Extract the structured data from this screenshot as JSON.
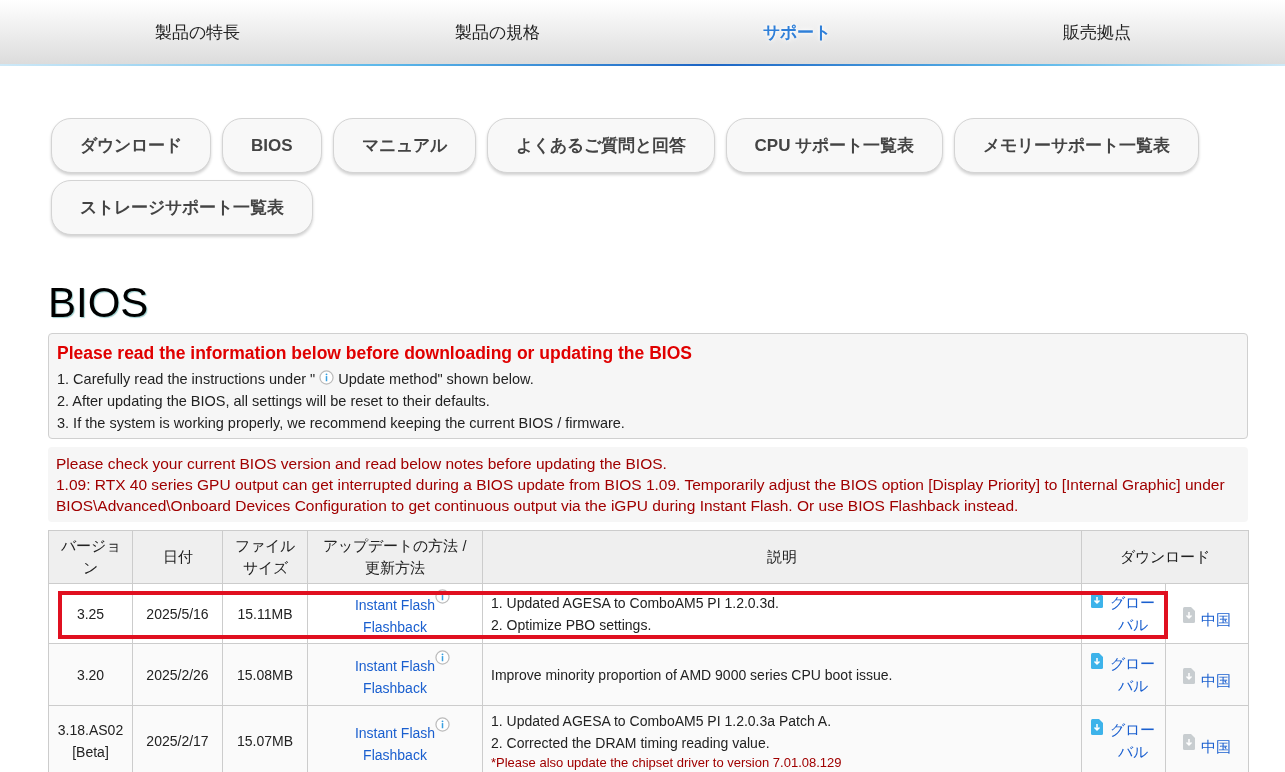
{
  "nav": {
    "items": [
      {
        "label": "製品の特長",
        "selected": false
      },
      {
        "label": "製品の規格",
        "selected": false
      },
      {
        "label": "サポート",
        "selected": true
      },
      {
        "label": "販売拠点",
        "selected": false
      }
    ]
  },
  "support_buttons": [
    "ダウンロード",
    "BIOS",
    "マニュアル",
    "よくあるご質問と回答",
    "CPU サポート一覧表",
    "メモリーサポート一覧表",
    "ストレージサポート一覧表"
  ],
  "heading": "BIOS",
  "notice": {
    "title": "Please read the information below before downloading or updating the BIOS",
    "items": [
      {
        "before": "1. Carefully read the instructions under \" ",
        "info": true,
        "after": " Update method\" shown below."
      },
      {
        "before": "2. After updating the BIOS, all settings will be reset to their defaults.",
        "info": false
      },
      {
        "before": "3. If the system is working properly, we recommend keeping the current BIOS / firmware.",
        "info": false
      }
    ]
  },
  "warning": [
    "Please check your current BIOS version and read below notes before updating the BIOS.",
    "1.09: RTX 40 series GPU output can get interrupted during a BIOS update from BIOS 1.09. Temporarily adjust the BIOS option [Display Priority] to [Internal Graphic] under BIOS\\Advanced\\Onboard Devices Configuration to get continuous output via the iGPU during Instant Flash. Or use BIOS Flashback instead."
  ],
  "table": {
    "columns": [
      "バージョン",
      "日付",
      "ファイルサイズ",
      "アップデートの方法 / 更新方法",
      "説明",
      "ダウンロード"
    ],
    "rows": [
      {
        "highlighted": true,
        "version": "3.25",
        "date": "2025/5/16",
        "size": "15.11MB",
        "methods": [
          {
            "label": "Instant Flash",
            "info": true
          },
          {
            "label": "Flashback",
            "info": false
          }
        ],
        "description": [
          {
            "kind": "line",
            "text": "1. Updated AGESA to ComboAM5 PI 1.2.0.3d."
          },
          {
            "kind": "line",
            "text": "2. Optimize PBO settings."
          }
        ],
        "downloads": [
          {
            "label": "グローバル",
            "primary": true
          },
          {
            "label": "中国",
            "primary": false
          }
        ]
      },
      {
        "highlighted": false,
        "version": "3.20",
        "date": "2025/2/26",
        "size": "15.08MB",
        "methods": [
          {
            "label": "Instant Flash",
            "info": true
          },
          {
            "label": "Flashback",
            "info": false
          }
        ],
        "description": [
          {
            "kind": "line",
            "text": "Improve minority proportion of AMD 9000 series CPU boot issue."
          }
        ],
        "downloads": [
          {
            "label": "グローバル",
            "primary": true
          },
          {
            "label": "中国",
            "primary": false
          }
        ]
      },
      {
        "highlighted": false,
        "version": "3.18.AS02 [Beta]",
        "date": "2025/2/17",
        "size": "15.07MB",
        "methods": [
          {
            "label": "Instant Flash",
            "info": true
          },
          {
            "label": "Flashback",
            "info": false
          }
        ],
        "description": [
          {
            "kind": "line",
            "text": "1. Updated AGESA to ComboAM5 PI 1.2.0.3a Patch A."
          },
          {
            "kind": "line",
            "text": "2. Corrected the DRAM timing reading value."
          },
          {
            "kind": "note",
            "text": "*Please also update the chipset driver to version 7.01.08.129"
          }
        ],
        "downloads": [
          {
            "label": "グローバル",
            "primary": true
          },
          {
            "label": "中国",
            "primary": false
          }
        ]
      }
    ]
  }
}
